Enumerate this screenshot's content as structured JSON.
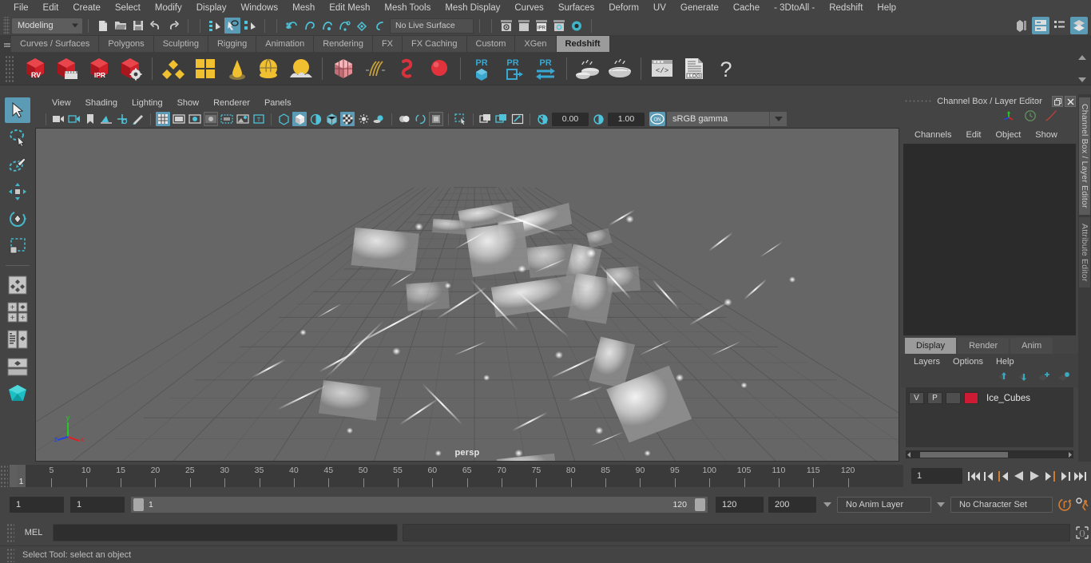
{
  "menubar": {
    "items": [
      "File",
      "Edit",
      "Create",
      "Select",
      "Modify",
      "Display",
      "Windows",
      "Mesh",
      "Edit Mesh",
      "Mesh Tools",
      "Mesh Display",
      "Curves",
      "Surfaces",
      "Deform",
      "UV",
      "Generate",
      "Cache",
      "- 3DtoAll -",
      "Redshift",
      "Help"
    ]
  },
  "statusbar": {
    "mode": "Modeling",
    "live_surface": "No Live Surface",
    "icons": [
      "new-scene-icon",
      "open-scene-icon",
      "save-scene-icon",
      "undo-icon",
      "redo-icon",
      "select-hierarchy-icon",
      "select-object-icon",
      "select-component-icon",
      "snap-grid-icon",
      "snap-curve-icon",
      "snap-point-icon",
      "snap-projected-icon",
      "snap-view-plane-icon",
      "make-live-icon",
      "render-view-icon",
      "render-region-icon",
      "ipr-render-icon",
      "render-settings-icon",
      "hypershade-icon"
    ],
    "right_icons": [
      "show-hide-modeling-toolkit-icon",
      "show-hide-attribute-editor-icon",
      "show-hide-tool-settings-icon",
      "show-hide-channel-box-icon"
    ]
  },
  "shelf": {
    "tabs": [
      "Curves / Surfaces",
      "Polygons",
      "Sculpting",
      "Rigging",
      "Animation",
      "Rendering",
      "FX",
      "FX Caching",
      "Custom",
      "XGen",
      "Redshift"
    ],
    "active_tab": "Redshift",
    "items": [
      {
        "name": "redshift-render-view",
        "label": "RV"
      },
      {
        "name": "redshift-render-sequence",
        "label": ""
      },
      {
        "name": "redshift-ipr-render",
        "label": "IPR"
      },
      {
        "name": "redshift-render-settings",
        "label": ""
      },
      {
        "name": "redshift-material-icon",
        "label": ""
      },
      {
        "name": "redshift-grid-icon",
        "label": ""
      },
      {
        "name": "redshift-light-cone-icon",
        "label": ""
      },
      {
        "name": "redshift-dome-light-icon",
        "label": ""
      },
      {
        "name": "redshift-environment-icon",
        "label": ""
      },
      {
        "name": "redshift-proxy-cube-icon",
        "label": ""
      },
      {
        "name": "redshift-hair-icon",
        "label": ""
      },
      {
        "name": "redshift-volume-icon",
        "label": ""
      },
      {
        "name": "redshift-sphere-icon",
        "label": ""
      },
      {
        "name": "redshift-pr-object-icon",
        "label": "PR"
      },
      {
        "name": "redshift-pr-export-icon",
        "label": "PR"
      },
      {
        "name": "redshift-pr-swap-icon",
        "label": "PR"
      },
      {
        "name": "redshift-bake-small-icon",
        "label": ""
      },
      {
        "name": "redshift-bake-large-icon",
        "label": ""
      },
      {
        "name": "redshift-script-icon",
        "label": ""
      },
      {
        "name": "redshift-log-icon",
        "label": ".LOG"
      },
      {
        "name": "redshift-help-icon",
        "label": "?"
      }
    ]
  },
  "toolbox": {
    "items": [
      "select-tool",
      "lasso-select-tool",
      "paint-select-tool",
      "move-tool",
      "rotate-tool",
      "scale-tool",
      "last-tool-used",
      "snap-align-tool",
      "layout-quad-icon",
      "outliner-persp-layout-icon",
      "persp-layout-icon",
      "maya-logo-icon"
    ]
  },
  "viewport": {
    "menus": [
      "View",
      "Shading",
      "Lighting",
      "Show",
      "Renderer",
      "Panels"
    ],
    "camera_label": "persp",
    "exposure": "0.00",
    "gamma": "1.00",
    "color_management": "sRGB gamma",
    "gamma_toggle": "ON",
    "axis": {
      "x": "x",
      "y": "y",
      "z": "z"
    },
    "toolbar_icons": [
      "select-camera-icon",
      "camera-attributes-icon",
      "bookmark-icon",
      "image-plane-icon",
      "2d-pan-zoom-icon",
      "grease-pencil-icon",
      "grid-icon",
      "film-gate-icon",
      "resolution-gate-icon",
      "gate-mask-icon",
      "film-origin-icon",
      "exposure-icon",
      "xray-icon",
      "wireframe-icon",
      "smooth-shade-icon",
      "flat-shade-icon",
      "wireframe-on-shaded-icon",
      "textured-icon",
      "lights-icon",
      "shadows-icon",
      "ao-icon",
      "motion-blur-icon",
      "multisample-icon",
      "isolate-select-icon",
      "xray-joints-icon",
      "xray-active-components-icon",
      "viewport-snapshot-icon"
    ]
  },
  "right_panel": {
    "title": "Channel Box / Layer Editor",
    "menus": [
      "Channels",
      "Edit",
      "Object",
      "Show"
    ],
    "header_icons": [
      "transform-axis-icon",
      "clock-icon",
      "curve-icon"
    ],
    "window_buttons": [
      "restore-icon",
      "close-icon"
    ],
    "layer_tabs": [
      "Display",
      "Render",
      "Anim"
    ],
    "active_layer_tab": "Display",
    "layer_menus": [
      "Layers",
      "Options",
      "Help"
    ],
    "layer_buttons": [
      "move-layer-up-icon",
      "move-layer-down-icon",
      "new-layer-icon",
      "new-layer-from-selected-icon"
    ],
    "layers": [
      {
        "visibility": "V",
        "playback": "P",
        "shading": "",
        "color": "#cc1b33",
        "name": "Ice_Cubes"
      }
    ],
    "vertical_tabs": [
      "Channel Box / Layer Editor",
      "Attribute Editor"
    ]
  },
  "timeline": {
    "ticks": [
      5,
      10,
      15,
      20,
      25,
      30,
      35,
      40,
      45,
      50,
      55,
      60,
      65,
      70,
      75,
      80,
      85,
      90,
      95,
      100,
      105,
      110,
      115,
      120
    ],
    "current_frame": "1",
    "current_frame_field": "1",
    "playback_buttons": [
      "go-to-start-icon",
      "step-back-keyframe-icon",
      "step-back-frame-icon",
      "play-backwards-icon",
      "play-forwards-icon",
      "step-forward-frame-icon",
      "step-forward-keyframe-icon",
      "go-to-end-icon"
    ]
  },
  "range": {
    "start_field": "1",
    "anim_start_field": "1",
    "slider_start": "1",
    "slider_end": "120",
    "anim_end_field": "120",
    "end_field": "200",
    "anim_layer": "No Anim Layer",
    "character_set": "No Character Set",
    "right_icons": [
      "auto-key-icon",
      "animation-preferences-icon"
    ]
  },
  "mel": {
    "label": "MEL",
    "input_value": "",
    "output_value": "",
    "script-editor-icon": "script-editor-icon"
  },
  "helpline": {
    "text": "Select Tool: select an object"
  },
  "colors": {
    "accent": "#5b9bb5",
    "panel_bg": "#444444",
    "viewport_bg": "#666666",
    "layer_red": "#cc1b33",
    "orange": "#d07b32"
  }
}
